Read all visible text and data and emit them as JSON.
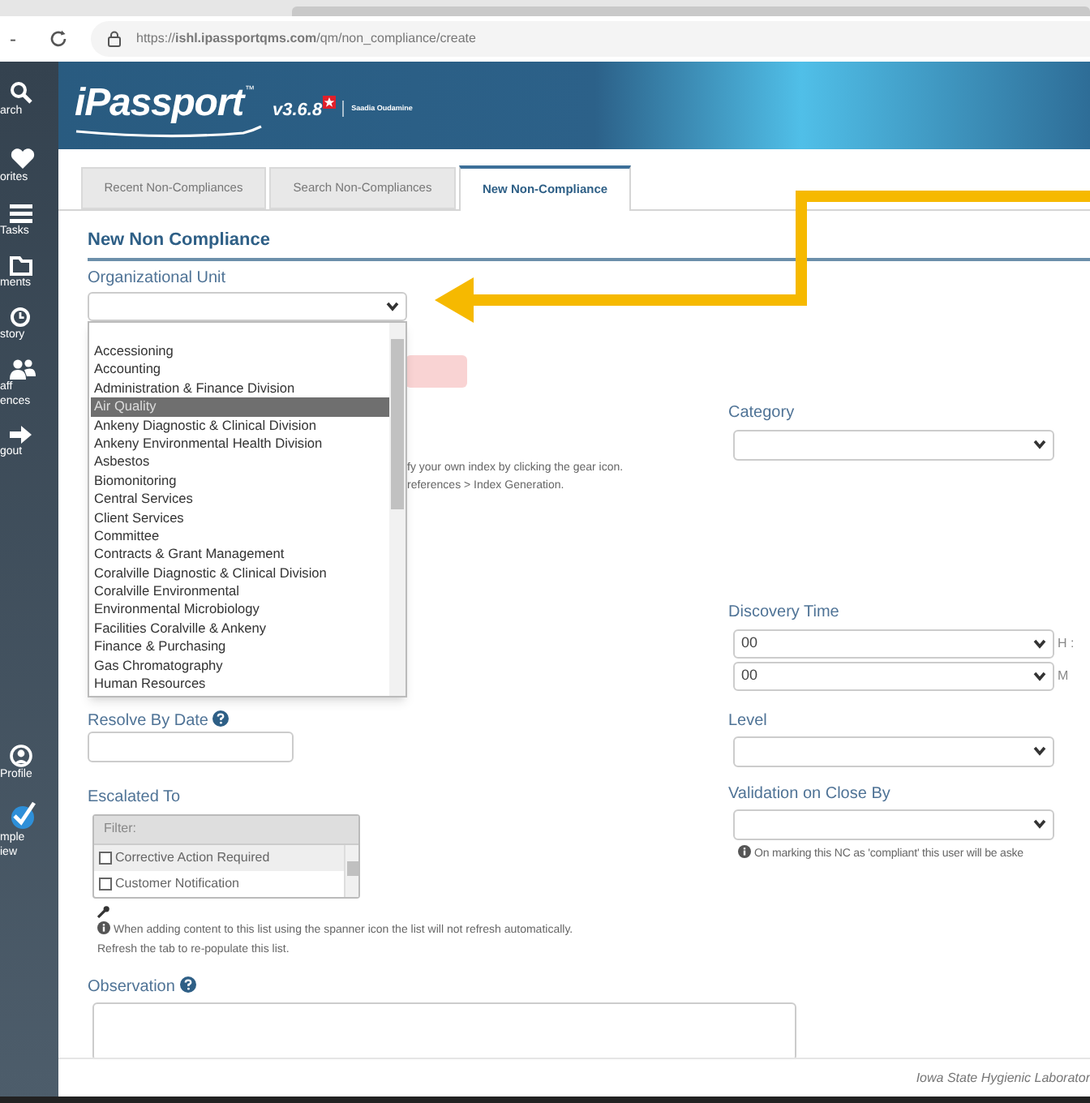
{
  "browser": {
    "back": "-",
    "url": "https://**ishl.ipassportqms.com**/qm/non_compliance/create"
  },
  "header": {
    "logo": "iPassport",
    "trademark": "™",
    "version": "v3.6.8",
    "user": "Saadia Oudamine"
  },
  "sidebar": [
    {
      "lines": [
        "arch"
      ]
    },
    {
      "lines": [
        "orites"
      ]
    },
    {
      "lines": [
        "Tasks"
      ]
    },
    {
      "lines": [
        "ments"
      ]
    },
    {
      "lines": [
        "story"
      ]
    },
    {
      "lines": [
        "aff",
        "ences"
      ]
    },
    {
      "lines": [
        "gout"
      ]
    },
    {
      "lines": [
        "Profile"
      ]
    },
    {
      "lines": [
        "mple",
        "iew"
      ]
    }
  ],
  "tabs": [
    {
      "label": "Recent Non-Compliances",
      "selected": false
    },
    {
      "label": "Search Non-Compliances",
      "selected": false
    },
    {
      "label": "New Non-Compliance",
      "selected": true
    }
  ],
  "form": {
    "title": "New Non Compliance",
    "org_unit": {
      "label": "Organizational Unit",
      "options": [
        {
          "label": "Accessioning",
          "selected": false
        },
        {
          "label": "Accounting",
          "selected": false
        },
        {
          "label": "Administration & Finance Division",
          "selected": false
        },
        {
          "label": "Air Quality",
          "selected": true
        },
        {
          "label": "Ankeny Diagnostic & Clinical Division",
          "selected": false
        },
        {
          "label": "Ankeny Environmental Health Division",
          "selected": false
        },
        {
          "label": "Asbestos",
          "selected": false
        },
        {
          "label": "Biomonitoring",
          "selected": false
        },
        {
          "label": "Central Services",
          "selected": false
        },
        {
          "label": "Client Services",
          "selected": false
        },
        {
          "label": "Committee",
          "selected": false
        },
        {
          "label": "Contracts & Grant Management",
          "selected": false
        },
        {
          "label": "Coralville Diagnostic & Clinical Division",
          "selected": false
        },
        {
          "label": "Coralville Environmental",
          "selected": false
        },
        {
          "label": "Environmental Microbiology",
          "selected": false
        },
        {
          "label": "Facilities Coralville & Ankeny",
          "selected": false
        },
        {
          "label": "Finance & Purchasing",
          "selected": false
        },
        {
          "label": "Gas Chromatography",
          "selected": false
        },
        {
          "label": "Human Resources",
          "selected": false
        }
      ]
    },
    "hint_lines": [
      "fy your own index by clicking the gear icon.",
      "references > Index Generation."
    ],
    "resolve_by_date": {
      "label": "Resolve By Date"
    },
    "escalated_to": {
      "label": "Escalated To",
      "filter_placeholder": "Filter:",
      "items": [
        {
          "label": "Corrective Action Required",
          "checked": false
        },
        {
          "label": "Customer Notification",
          "checked": false
        }
      ],
      "note_lines": [
        "When adding content to this list using the spanner icon the list will not refresh automatically.",
        "Refresh the tab to re-populate this list."
      ]
    },
    "observation": {
      "label": "Observation"
    },
    "category": {
      "label": "Category"
    },
    "discovery_time": {
      "label": "Discovery Time",
      "hour": "00",
      "hour_suffix": "H :",
      "minute": "00",
      "minute_suffix": "M"
    },
    "level": {
      "label": "Level"
    },
    "validation": {
      "label": "Validation on Close By",
      "note": "On marking this NC as 'compliant' this user will be aske"
    }
  },
  "footer": {
    "text": "Iowa State Hygienic Laborator"
  }
}
